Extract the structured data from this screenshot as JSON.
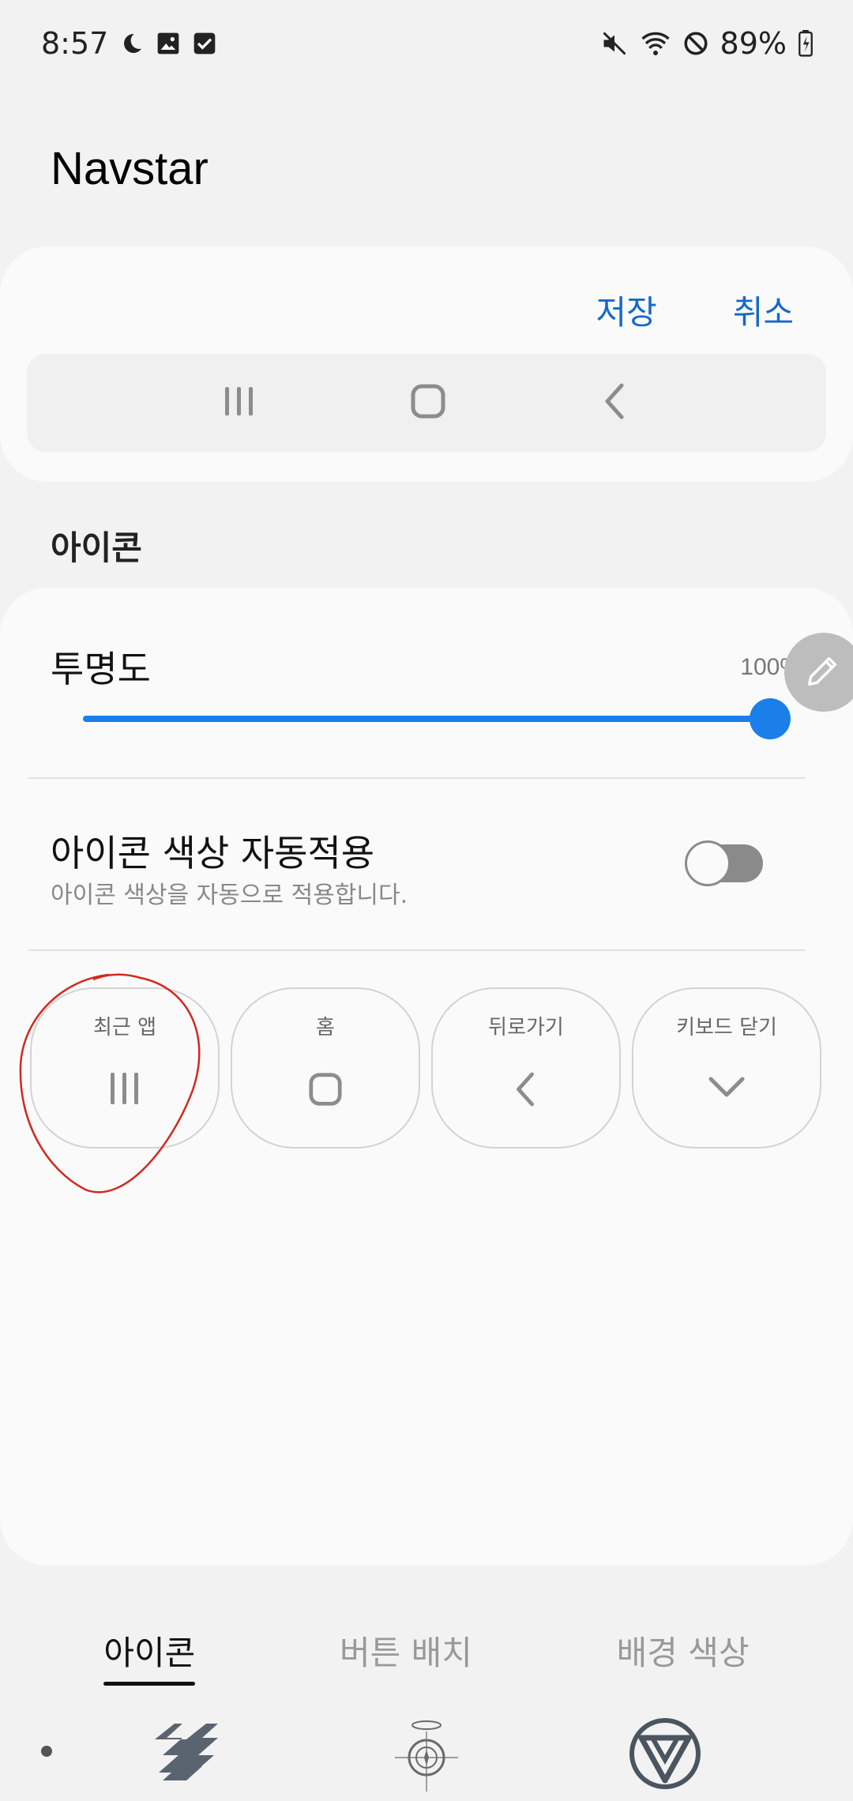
{
  "status_bar": {
    "time": "8:57",
    "battery": "89%",
    "icons_left": [
      "moon-icon",
      "image-icon",
      "checkbox-icon"
    ],
    "icons_right": [
      "mute-icon",
      "wifi-icon",
      "block-icon",
      "battery-icon"
    ]
  },
  "app": {
    "title": "Navstar"
  },
  "preview": {
    "save_label": "저장",
    "cancel_label": "취소",
    "nav_icons": [
      "recents-icon",
      "home-icon",
      "back-icon"
    ]
  },
  "section": {
    "title": "아이콘"
  },
  "opacity": {
    "label": "투명도",
    "value_text": "100%",
    "value": 100
  },
  "auto_color": {
    "title": "아이콘 색상 자동적용",
    "subtitle": "아이콘 색상을 자동으로 적용합니다.",
    "enabled": false
  },
  "icon_buttons": [
    {
      "label": "최근 앱",
      "icon": "recents-icon"
    },
    {
      "label": "홈",
      "icon": "home-icon"
    },
    {
      "label": "뒤로가기",
      "icon": "back-icon"
    },
    {
      "label": "키보드 닫기",
      "icon": "chevron-down-icon"
    }
  ],
  "tabs": [
    {
      "label": "아이콘",
      "active": true
    },
    {
      "label": "버튼 배치",
      "active": false
    },
    {
      "label": "배경 색상",
      "active": false
    }
  ],
  "colors": {
    "accent": "#1669c7",
    "slider": "#1a7fe8",
    "annotation": "#d12a1f"
  }
}
